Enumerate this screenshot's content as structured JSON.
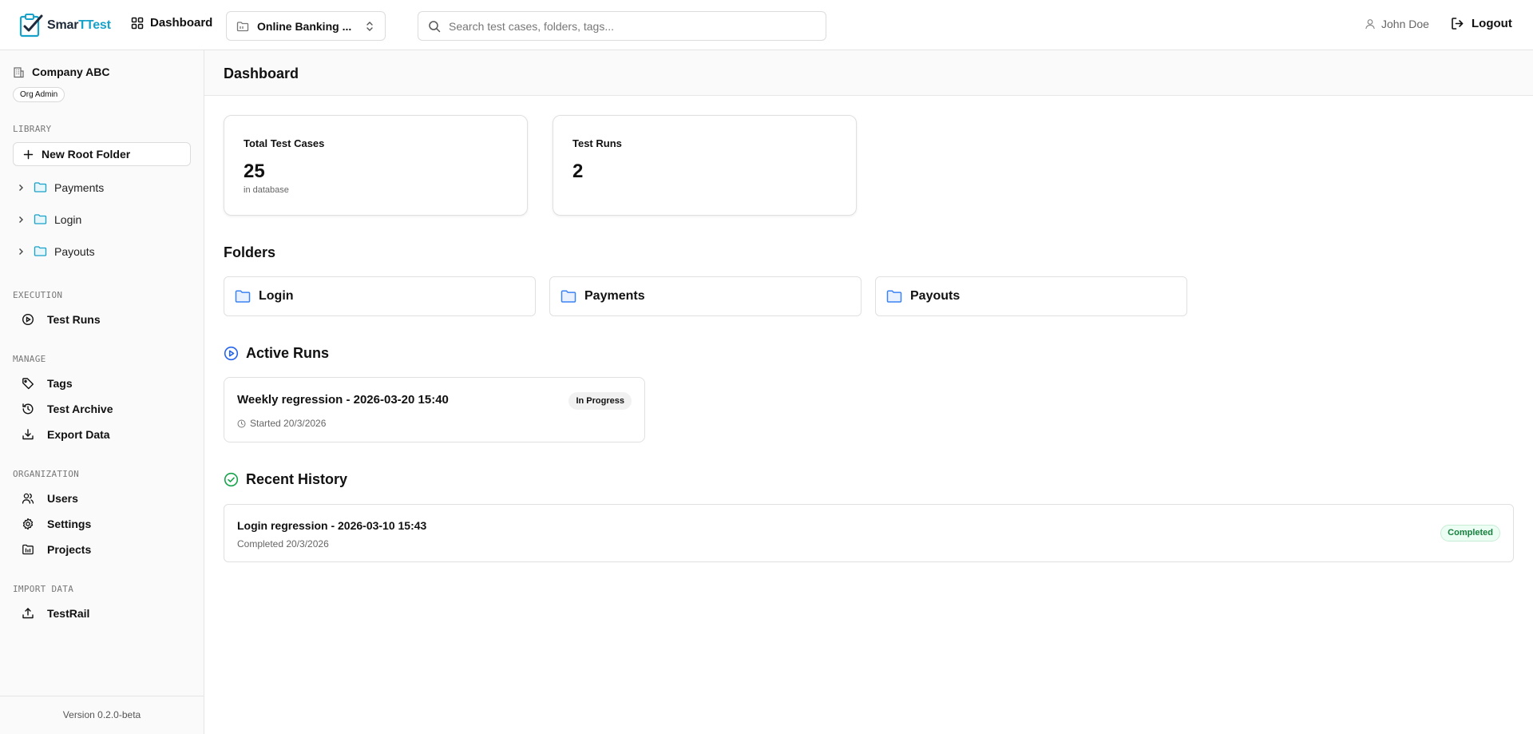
{
  "app": {
    "logo_part1": "Smar",
    "logo_part2": "TTest",
    "dashboard_nav": "Dashboard",
    "project": "Online Banking ...",
    "search_placeholder": "Search test cases, folders, tags...",
    "user": "John Doe",
    "logout": "Logout",
    "brand_color": "#19a2c9"
  },
  "sidebar": {
    "org_name": "Company ABC",
    "role": "Org Admin",
    "library_label": "LIBRARY",
    "new_root_folder": "New Root Folder",
    "folders": [
      "Payments",
      "Login",
      "Payouts"
    ],
    "execution_label": "EXECUTION",
    "test_runs": "Test Runs",
    "manage_label": "MANAGE",
    "tags": "Tags",
    "test_archive": "Test Archive",
    "export_data": "Export Data",
    "organization_label": "ORGANIZATION",
    "users": "Users",
    "settings": "Settings",
    "projects": "Projects",
    "import_label": "IMPORT DATA",
    "testrail": "TestRail",
    "version": "Version 0.2.0-beta"
  },
  "main": {
    "title": "Dashboard",
    "stats": [
      {
        "title": "Total Test Cases",
        "value": "25",
        "sub": "in database"
      },
      {
        "title": "Test Runs",
        "value": "2",
        "sub": ""
      }
    ],
    "folders_heading": "Folders",
    "folders": [
      "Login",
      "Payments",
      "Payouts"
    ],
    "active_runs_heading": "Active Runs",
    "active_run": {
      "title": "Weekly regression - 2026-03-20 15:40",
      "status": "In Progress",
      "started": "Started 20/3/2026"
    },
    "history_heading": "Recent History",
    "history_item": {
      "title": "Login regression - 2026-03-10 15:43",
      "meta": "Completed 20/3/2026",
      "status": "Completed"
    }
  }
}
